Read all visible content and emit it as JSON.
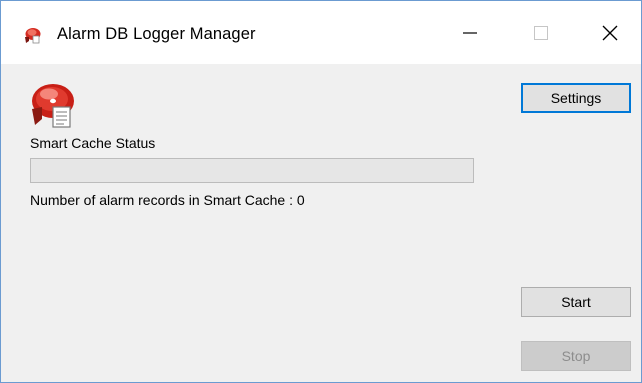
{
  "window": {
    "title": "Alarm DB Logger Manager",
    "app_icon": "alarm-logger-icon"
  },
  "titlebar": {
    "minimize_icon": "minimize-icon",
    "maximize_icon": "maximize-icon",
    "close_icon": "close-icon"
  },
  "main": {
    "cache_status_label": "Smart Cache Status",
    "progress": 0,
    "records_label": "Number of alarm records in Smart Cache :  0"
  },
  "buttons": {
    "settings": "Settings",
    "start": "Start",
    "stop": "Stop"
  },
  "colors": {
    "window_border": "#6b9bd1",
    "focus_border": "#0078d7",
    "icon_red": "#d42a20"
  }
}
